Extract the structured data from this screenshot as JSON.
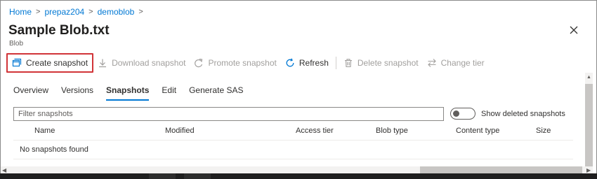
{
  "breadcrumb": [
    {
      "label": "Home"
    },
    {
      "label": "prepaz204"
    },
    {
      "label": "demoblob"
    }
  ],
  "breadcrumb_separator": ">",
  "header": {
    "title": "Sample Blob.txt",
    "subtitle": "Blob",
    "close_icon": "close-icon"
  },
  "toolbar": {
    "create_snapshot": "Create snapshot",
    "download_snapshot": "Download snapshot",
    "promote_snapshot": "Promote snapshot",
    "refresh": "Refresh",
    "delete_snapshot": "Delete snapshot",
    "change_tier": "Change tier"
  },
  "tabs": [
    {
      "label": "Overview"
    },
    {
      "label": "Versions"
    },
    {
      "label": "Snapshots",
      "selected": true
    },
    {
      "label": "Edit"
    },
    {
      "label": "Generate SAS"
    }
  ],
  "filter": {
    "placeholder": "Filter snapshots",
    "value": ""
  },
  "toggle": {
    "label": "Show deleted snapshots",
    "on": false
  },
  "table": {
    "columns": [
      "Name",
      "Modified",
      "Access tier",
      "Blob type",
      "Content type",
      "Size"
    ],
    "empty_message": "No snapshots found"
  },
  "colors": {
    "accent": "#0078d4",
    "highlight_border": "#d13438",
    "disabled_text": "#a19f9d"
  }
}
